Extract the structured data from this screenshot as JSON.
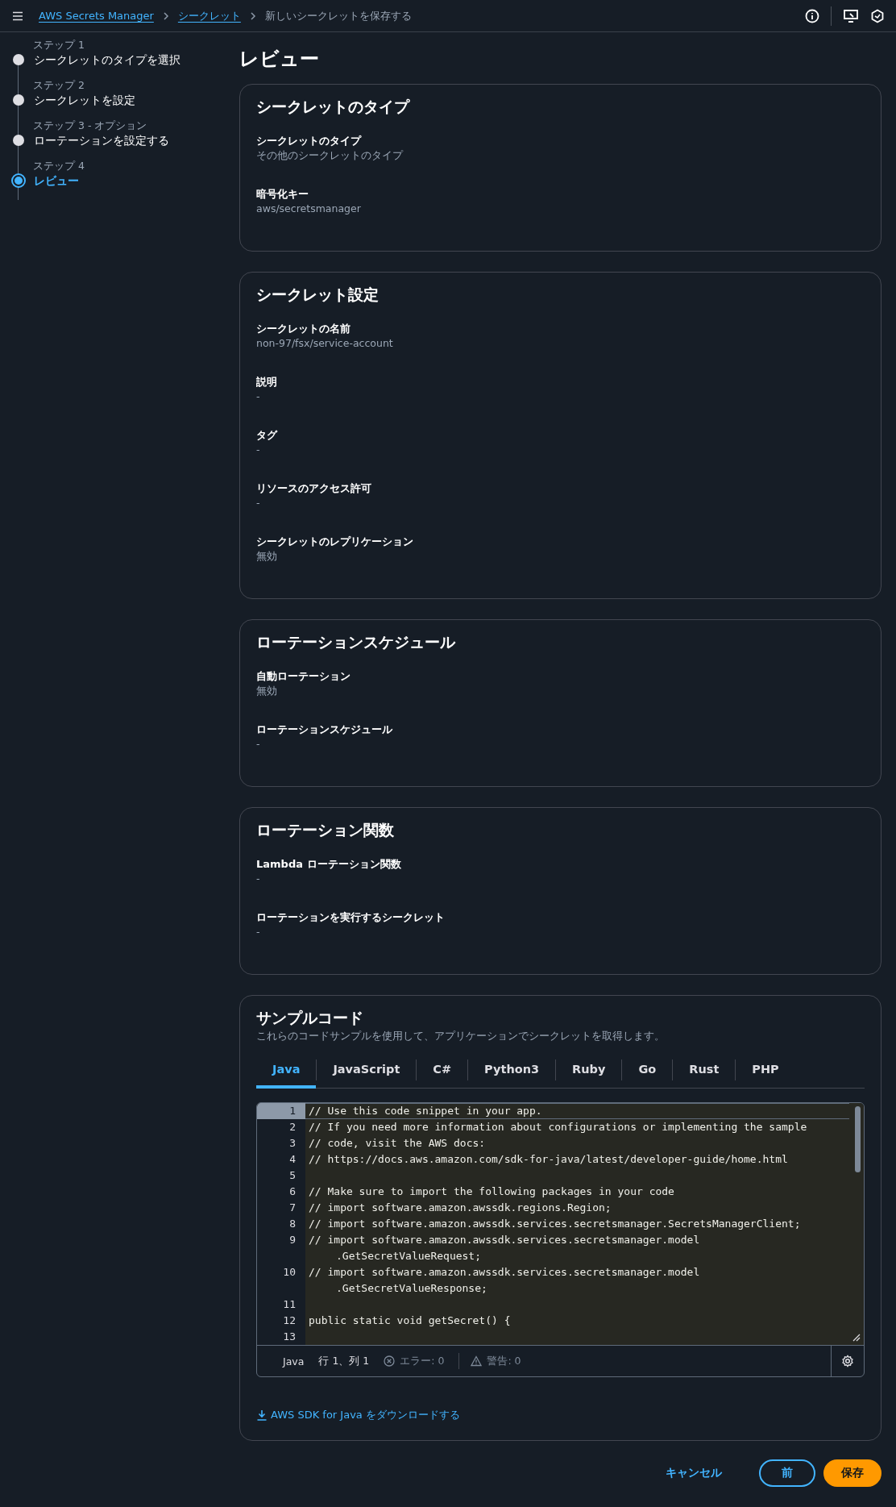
{
  "breadcrumbs": [
    {
      "label": "AWS Secrets Manager",
      "link": true
    },
    {
      "label": "シークレット",
      "link": true
    },
    {
      "label": "新しいシークレットを保存する",
      "link": false
    }
  ],
  "steps": [
    {
      "label": "ステップ 1",
      "title": "シークレットのタイプを選択",
      "selected": false
    },
    {
      "label": "ステップ 2",
      "title": "シークレットを設定",
      "selected": false
    },
    {
      "label": "ステップ 3 - オプション",
      "title": "ローテーションを設定する",
      "selected": false
    },
    {
      "label": "ステップ 4",
      "title": "レビュー",
      "selected": true
    }
  ],
  "page_title": "レビュー",
  "sections": [
    {
      "title": "シークレットのタイプ",
      "fields": [
        {
          "label": "シークレットのタイプ",
          "value": "その他のシークレットのタイプ"
        },
        {
          "label": "暗号化キー",
          "value": "aws/secretsmanager"
        }
      ]
    },
    {
      "title": "シークレット設定",
      "fields": [
        {
          "label": "シークレットの名前",
          "value": "non-97/fsx/service-account"
        },
        {
          "label": "説明",
          "value": "-"
        },
        {
          "label": "タグ",
          "value": "-"
        },
        {
          "label": "リソースのアクセス許可",
          "value": "-"
        },
        {
          "label": "シークレットのレプリケーション",
          "value": "無効"
        }
      ]
    },
    {
      "title": "ローテーションスケジュール",
      "fields": [
        {
          "label": "自動ローテーション",
          "value": "無効"
        },
        {
          "label": "ローテーションスケジュール",
          "value": "-"
        }
      ]
    },
    {
      "title": "ローテーション関数",
      "fields": [
        {
          "label": "Lambda ローテーション関数",
          "value": "-"
        },
        {
          "label": "ローテーションを実行するシークレット",
          "value": "-"
        }
      ]
    }
  ],
  "sample_code": {
    "title": "サンプルコード",
    "description": "これらのコードサンプルを使用して、アプリケーションでシークレットを取得します。",
    "tabs": [
      {
        "label": "Java",
        "selected": true
      },
      {
        "label": "JavaScript",
        "selected": false
      },
      {
        "label": "C#",
        "selected": false
      },
      {
        "label": "Python3",
        "selected": false
      },
      {
        "label": "Ruby",
        "selected": false
      },
      {
        "label": "Go",
        "selected": false
      },
      {
        "label": "Rust",
        "selected": false
      },
      {
        "label": "PHP",
        "selected": false
      }
    ],
    "code_lines": [
      {
        "number": "1",
        "text": "// Use this code snippet in your app.",
        "active": true
      },
      {
        "number": "2",
        "text": "// If you need more information about configurations or implementing the sample",
        "active": false
      },
      {
        "number": "3",
        "text": "// code, visit the AWS docs:",
        "active": false
      },
      {
        "number": "4",
        "text": "// https://docs.aws.amazon.com/sdk-for-java/latest/developer-guide/home.html",
        "active": false
      },
      {
        "number": "5",
        "active": false
      },
      {
        "number": "6",
        "text": "// Make sure to import the following packages in your code",
        "active": false
      },
      {
        "number": "7",
        "text": "// import software.amazon.awssdk.regions.Region;",
        "active": false
      },
      {
        "number": "8",
        "text": "// import software.amazon.awssdk.services.secretsmanager.SecretsManagerClient;",
        "active": false
      },
      {
        "number": "9",
        "text": "// import software.amazon.awssdk.services.secretsmanager.model",
        "wrap": ".GetSecretValueRequest;",
        "active": false
      },
      {
        "number": "10",
        "text": "// import software.amazon.awssdk.services.secretsmanager.model",
        "wrap": ".GetSecretValueResponse;",
        "active": false
      },
      {
        "number": "11",
        "active": false
      },
      {
        "number": "12",
        "text": "public static void getSecret() {",
        "active": false
      },
      {
        "number": "13",
        "active": false
      }
    ],
    "status": {
      "language": "Java",
      "position": "行 1、列 1",
      "errors": "エラー: 0",
      "warnings": "警告: 0"
    },
    "download_link": "AWS SDK for Java をダウンロードする"
  },
  "buttons": [
    {
      "label": "キャンセル",
      "kind": "link"
    },
    {
      "label": "前",
      "kind": "normal"
    },
    {
      "label": "保存",
      "kind": "primary"
    }
  ]
}
